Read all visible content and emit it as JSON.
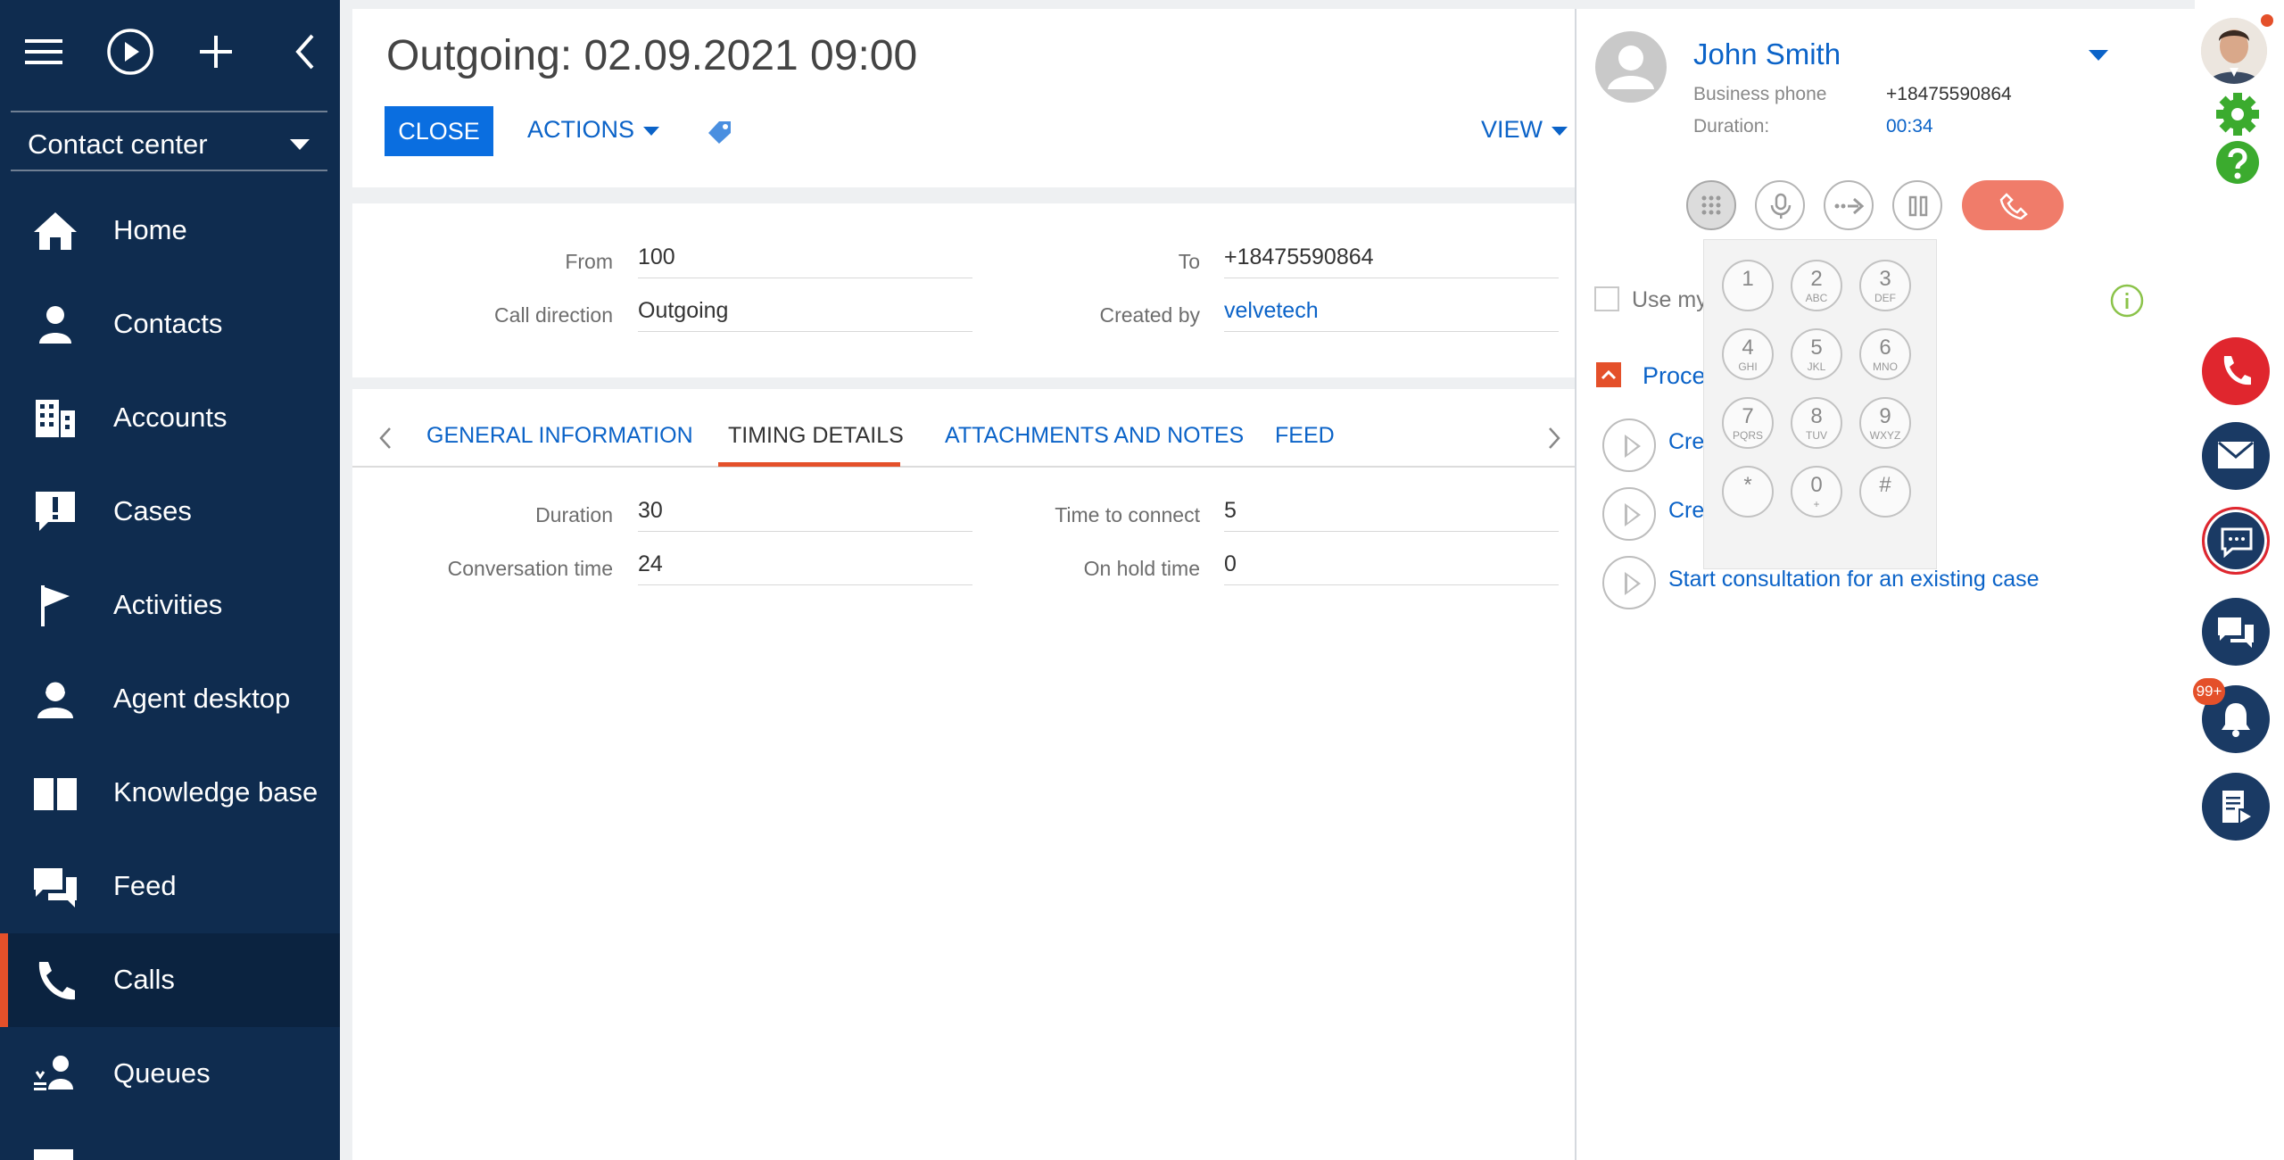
{
  "sidebar": {
    "workspace": "Contact center",
    "items": [
      {
        "label": "Home",
        "icon": "home-icon"
      },
      {
        "label": "Contacts",
        "icon": "person-icon"
      },
      {
        "label": "Accounts",
        "icon": "building-icon"
      },
      {
        "label": "Cases",
        "icon": "exclamation-icon"
      },
      {
        "label": "Activities",
        "icon": "flag-icon"
      },
      {
        "label": "Agent desktop",
        "icon": "agent-icon"
      },
      {
        "label": "Knowledge base",
        "icon": "book-icon"
      },
      {
        "label": "Feed",
        "icon": "chat-bubbles-icon"
      },
      {
        "label": "Calls",
        "icon": "phone-icon",
        "active": true
      },
      {
        "label": "Queues",
        "icon": "queue-icon"
      }
    ]
  },
  "page": {
    "title": "Outgoing: 02.09.2021 09:00",
    "close_label": "CLOSE",
    "actions_label": "ACTIONS",
    "view_label": "VIEW"
  },
  "fields": {
    "from_label": "From",
    "from_value": "100",
    "to_label": "To",
    "to_value": "+18475590864",
    "direction_label": "Call direction",
    "direction_value": "Outgoing",
    "created_label": "Created by",
    "created_value": "velvetech"
  },
  "tabs": {
    "items": [
      "GENERAL INFORMATION",
      "TIMING DETAILS",
      "ATTACHMENTS AND NOTES",
      "FEED"
    ],
    "active": "TIMING DETAILS"
  },
  "timing": {
    "duration_label": "Duration",
    "duration_value": "30",
    "connect_label": "Time to connect",
    "connect_value": "5",
    "conversation_label": "Conversation time",
    "conversation_value": "24",
    "hold_label": "On hold time",
    "hold_value": "0"
  },
  "cti": {
    "contact_name": "John Smith",
    "phone_label": "Business phone",
    "phone_value": "+18475590864",
    "duration_label": "Duration:",
    "duration_value": "00:34",
    "use_my_label": "Use my",
    "process_label": "Proce",
    "create_link_1": "Cre",
    "create_link_2": "Cre",
    "consultation_link": "Start consultation for an existing case",
    "keys": [
      {
        "digit": "1",
        "letters": ""
      },
      {
        "digit": "2",
        "letters": "ABC"
      },
      {
        "digit": "3",
        "letters": "DEF"
      },
      {
        "digit": "4",
        "letters": "GHI"
      },
      {
        "digit": "5",
        "letters": "JKL"
      },
      {
        "digit": "6",
        "letters": "MNO"
      },
      {
        "digit": "7",
        "letters": "PQRS"
      },
      {
        "digit": "8",
        "letters": "TUV"
      },
      {
        "digit": "9",
        "letters": "WXYZ"
      },
      {
        "digit": "*",
        "letters": ""
      },
      {
        "digit": "0",
        "letters": "+"
      },
      {
        "digit": "#",
        "letters": ""
      }
    ]
  },
  "right_bar": {
    "notification_badge": "99+"
  },
  "colors": {
    "sidebar_bg": "#0f2c4f",
    "accent": "#e4502a",
    "link": "#0b63c8",
    "primary_button": "#0a6ee0",
    "hangup": "#f07c6a",
    "settings_green": "#3bab2e"
  }
}
